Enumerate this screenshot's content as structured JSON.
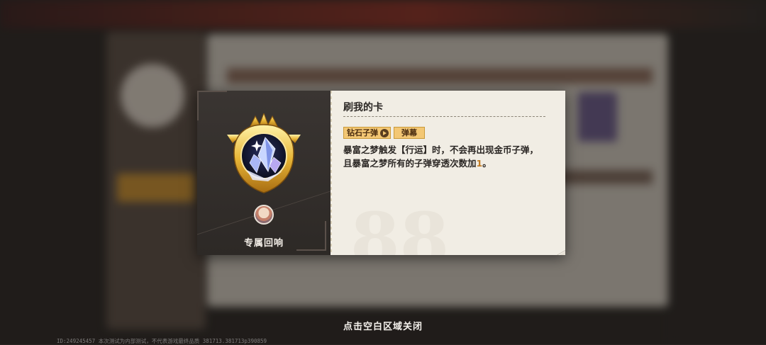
{
  "popup": {
    "card_title": "刷我的卡",
    "tags": [
      "钻石子弹",
      "弹幕"
    ],
    "description_lines": [
      {
        "parts": [
          "暴富之梦触发【行运】时，不会再出现金币子弹，"
        ]
      },
      {
        "parts": [
          "且暴富之梦所有的子弹穿透次数加",
          "1",
          "。"
        ]
      }
    ],
    "highlight_value": "1",
    "watermark": "88",
    "emblem_label": "专属回响",
    "emblem_icon": "diamond-crystal-crest-icon",
    "avatar_icon": "character-avatar-icon"
  },
  "close_hint": "点击空白区域关闭",
  "build_info": "ID:249245457 本次测试为内部测试，不代表游戏最终品质 381713.381713p390859",
  "colors": {
    "tag_bg": "#f3c774",
    "highlight": "#c07a22",
    "panel_dark": "#332e2b",
    "panel_light": "#f1ede4"
  }
}
